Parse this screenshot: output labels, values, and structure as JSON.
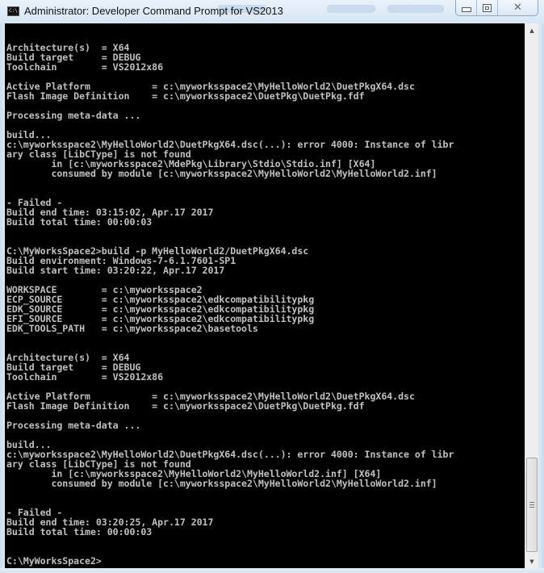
{
  "window": {
    "title": "Administrator: Developer Command Prompt for VS2013",
    "icon": "console-icon",
    "icon_text": "C:\\",
    "controls": {
      "minimize": "minimize-icon",
      "maximize": "maximize-icon",
      "close_glyph": "✕"
    }
  },
  "console": {
    "background": "#000000",
    "foreground": "#c0c0c0",
    "lines": [
      "Architecture(s)  = X64",
      "Build target     = DEBUG",
      "Toolchain        = VS2012x86",
      "",
      "Active Platform           = c:\\myworksspace2\\MyHelloWorld2\\DuetPkgX64.dsc",
      "Flash Image Definition    = c:\\myworksspace2\\DuetPkg\\DuetPkg.fdf",
      "",
      "Processing meta-data ...",
      "",
      "build...",
      "c:\\myworksspace2\\MyHelloWorld2\\DuetPkgX64.dsc(...): error 4000: Instance of libr",
      "ary class [LibCType] is not found",
      "        in [c:\\myworksspace2\\MdePkg\\Library\\Stdio\\Stdio.inf] [X64]",
      "        consumed by module [c:\\myworksspace2\\MyHelloWorld2\\MyHelloWorld2.inf]",
      "",
      "",
      "- Failed -",
      "Build end time: 03:15:02, Apr.17 2017",
      "Build total time: 00:00:03",
      "",
      "",
      "C:\\MyWorksSpace2>build -p MyHelloWorld2/DuetPkgX64.dsc",
      "Build environment: Windows-7-6.1.7601-SP1",
      "Build start time: 03:20:22, Apr.17 2017",
      "",
      "WORKSPACE        = c:\\myworksspace2",
      "ECP_SOURCE       = c:\\myworksspace2\\edkcompatibilitypkg",
      "EDK_SOURCE       = c:\\myworksspace2\\edkcompatibilitypkg",
      "EFI_SOURCE       = c:\\myworksspace2\\edkcompatibilitypkg",
      "EDK_TOOLS_PATH   = c:\\myworksspace2\\basetools",
      "",
      "",
      "Architecture(s)  = X64",
      "Build target     = DEBUG",
      "Toolchain        = VS2012x86",
      "",
      "Active Platform           = c:\\myworksspace2\\MyHelloWorld2\\DuetPkgX64.dsc",
      "Flash Image Definition    = c:\\myworksspace2\\DuetPkg\\DuetPkg.fdf",
      "",
      "Processing meta-data ...",
      "",
      "build...",
      "c:\\myworksspace2\\MyHelloWorld2\\DuetPkgX64.dsc(...): error 4000: Instance of libr",
      "ary class [LibCType] is not found",
      "        in [c:\\myworksspace2\\MyHelloWorld2\\MyHelloWorld2.inf] [X64]",
      "        consumed by module [c:\\myworksspace2\\MyHelloWorld2\\MyHelloWorld2.inf]",
      "",
      "",
      "- Failed -",
      "Build end time: 03:20:25, Apr.17 2017",
      "Build total time: 00:00:03",
      "",
      "",
      "C:\\MyWorksSpace2>"
    ]
  },
  "scrollbar": {
    "up_arrow": "▲",
    "down_arrow": "▼",
    "position_fraction": 0.95
  }
}
